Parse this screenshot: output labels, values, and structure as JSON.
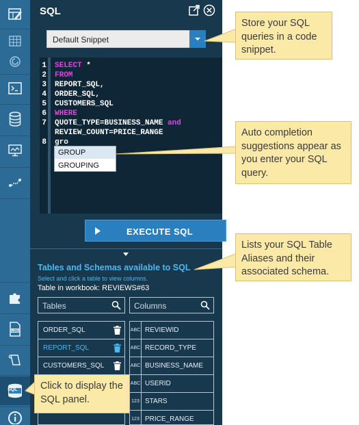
{
  "panel": {
    "title": "SQL",
    "snippet_select": "Default Snippet",
    "editor_lines": [
      {
        "n": "1",
        "parts": [
          {
            "t": "SELECT",
            "kw": true
          },
          {
            "t": " *",
            "kw": false
          }
        ]
      },
      {
        "n": "2",
        "parts": [
          {
            "t": "FROM",
            "kw": true
          }
        ]
      },
      {
        "n": "3",
        "parts": [
          {
            "t": "REPORT_SQL,",
            "kw": false
          }
        ]
      },
      {
        "n": "4",
        "parts": [
          {
            "t": "ORDER_SQL,",
            "kw": false
          }
        ]
      },
      {
        "n": "5",
        "parts": [
          {
            "t": "CUSTOMERS_SQL",
            "kw": false
          }
        ]
      },
      {
        "n": "6",
        "parts": [
          {
            "t": "WHERE",
            "kw": true
          }
        ]
      },
      {
        "n": "7",
        "parts": [
          {
            "t": "QUOTE_TYPE=BUSINESS_NAME ",
            "kw": false
          },
          {
            "t": "and",
            "kw": true
          }
        ]
      },
      {
        "n": "",
        "parts": [
          {
            "t": "REVIEW_COUNT=PRICE_RANGE",
            "kw": false
          }
        ]
      },
      {
        "n": "8",
        "parts": [
          {
            "t": "gro",
            "kw": false
          }
        ]
      }
    ],
    "autocomplete": [
      "GROUP",
      "GROUPING"
    ],
    "execute_label": "EXECUTE SQL",
    "tables_title": "Tables and Schemas available to SQL",
    "tables_hint": "Select and click a table to view columns.",
    "workbook_label": "Table in workbook:  REVIEWS#63",
    "tables_search": "Tables",
    "columns_search": "Columns",
    "tables": [
      {
        "name": "ORDER_SQL",
        "selected": false
      },
      {
        "name": "REPORT_SQL",
        "selected": true
      },
      {
        "name": "CUSTOMERS_SQL",
        "selected": false
      }
    ],
    "columns": [
      {
        "type": "ABC",
        "name": "REVIEWID"
      },
      {
        "type": "ABC",
        "name": "RECORD_TYPE"
      },
      {
        "type": "ABC",
        "name": "BUSINESS_NAME"
      },
      {
        "type": "ABC",
        "name": "USERID"
      },
      {
        "type": "123",
        "name": "STARS"
      },
      {
        "type": "123",
        "name": "PRICE_RANGE"
      }
    ]
  },
  "rail": {
    "sql_badge": "SQL"
  },
  "callouts": {
    "snippet": "Store your SQL queries in a code snippet.",
    "autocomplete": "Auto completion suggestions appear as you enter your SQL query.",
    "aliases": "Lists your SQL Table Aliases and their associated schema.",
    "open_panel": "Click to display the SQL panel."
  },
  "colors": {
    "panel_bg": "#18384e",
    "rail_bg": "#2b6b95",
    "accent": "#2a7fbf",
    "keyword": "#e63fe6",
    "link": "#4fb7f0",
    "callout_bg": "#fbe9a8"
  }
}
